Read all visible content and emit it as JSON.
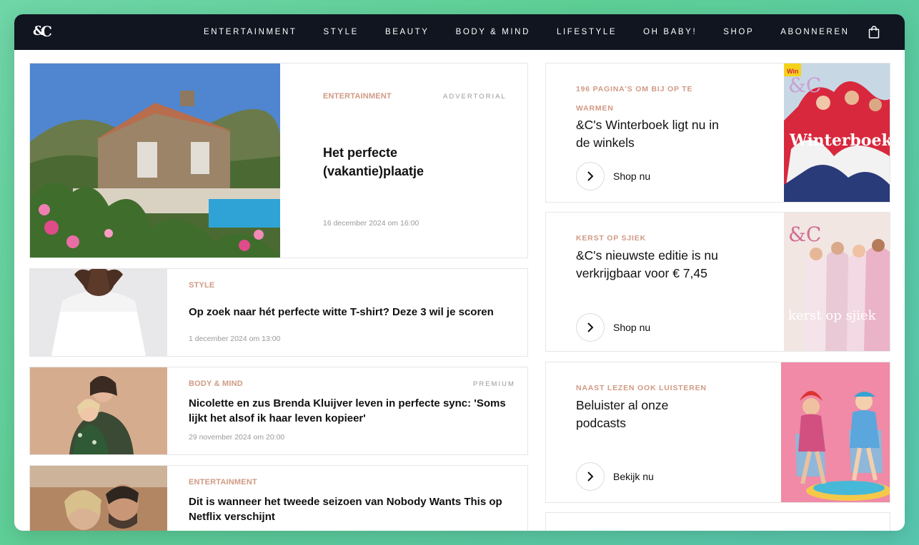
{
  "brand": {
    "logo": "&C"
  },
  "nav": {
    "items": [
      "ENTERTAINMENT",
      "STYLE",
      "BEAUTY",
      "BODY & MIND",
      "LIFESTYLE",
      "OH BABY!",
      "SHOP",
      "ABONNEREN"
    ]
  },
  "articles": [
    {
      "category": "ENTERTAINMENT",
      "tag": "ADVERTORIAL",
      "title": "Het perfecte (vakantie)plaatje",
      "date": "16 december 2024 om 16:00"
    },
    {
      "category": "STYLE",
      "tag": "",
      "title": "Op zoek naar hét perfecte witte T-shirt? Deze 3 wil je scoren",
      "date": "1 december 2024 om 13:00"
    },
    {
      "category": "BODY & MIND",
      "tag": "PREMIUM",
      "title": "Nicolette en zus Brenda Kluijver leven in perfecte sync: 'Soms lijkt het alsof ik haar leven kopieer'",
      "date": "29 november 2024 om 20:00"
    },
    {
      "category": "ENTERTAINMENT",
      "tag": "",
      "title": "Dit is wanneer het tweede seizoen van Nobody Wants This op Netflix verschijnt",
      "date": ""
    }
  ],
  "promos": [
    {
      "category": "196 PAGINA'S OM BIJ OP TE WARMEN",
      "title": "&C's Winterboek ligt nu in de winkels",
      "cta": "Shop nu",
      "cover_title": "Winterboek",
      "cover_brand": "&C"
    },
    {
      "category": "KERST OP SJIEK",
      "title": "&C's nieuwste editie is nu verkrijgbaar voor € 7,45",
      "cta": "Shop nu",
      "cover_title": "kerst op sjiek",
      "cover_brand": "&C"
    },
    {
      "category": "NAAST LEZEN OOK LUISTEREN",
      "title": "Beluister al onze podcasts",
      "cta": "Bekijk nu"
    }
  ],
  "colors": {
    "nav_bg": "#111520",
    "accent": "#d09a84",
    "background_gradient": "#5ecf96"
  }
}
